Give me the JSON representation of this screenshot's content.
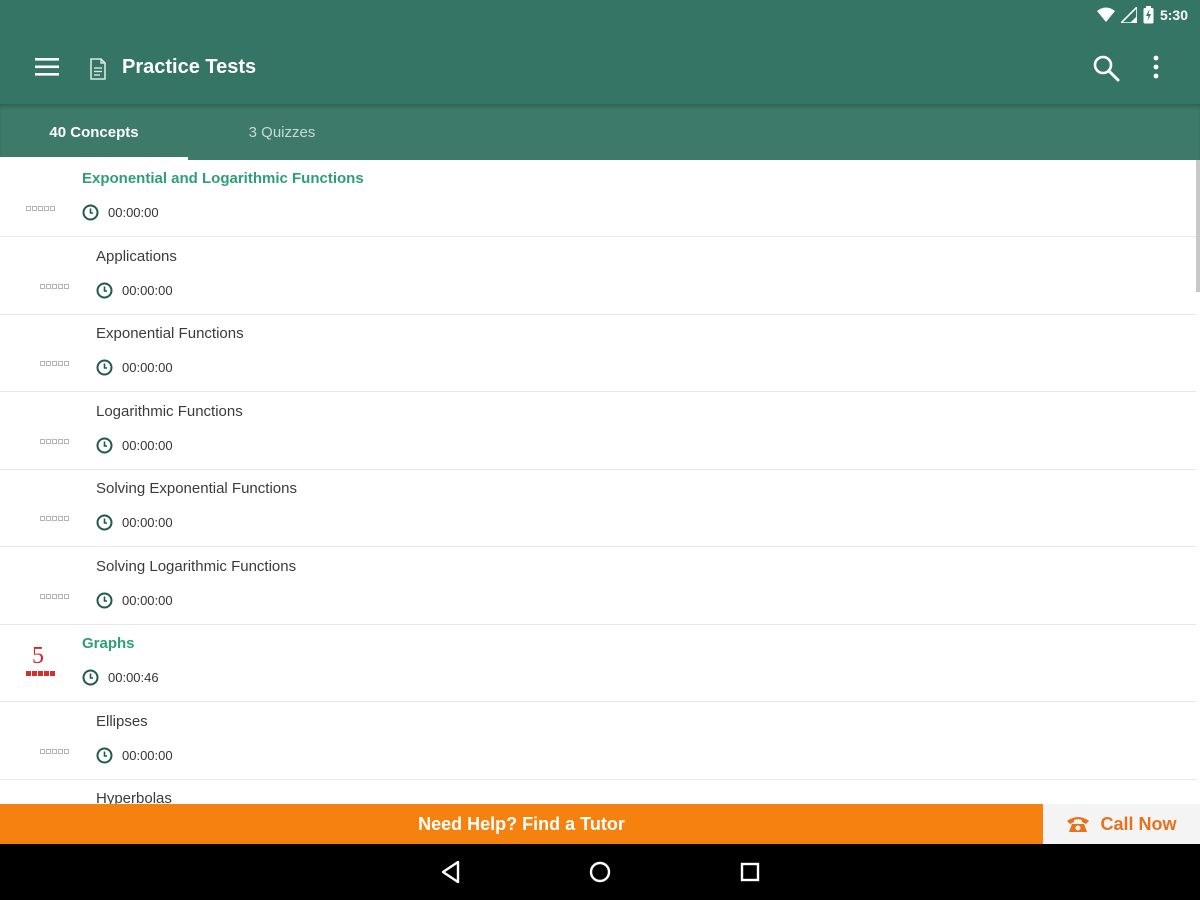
{
  "status": {
    "time": "5:30"
  },
  "toolbar": {
    "title": "Practice Tests"
  },
  "tabs": [
    {
      "label": "40 Concepts",
      "selected": true
    },
    {
      "label": "3 Quizzes",
      "selected": false
    }
  ],
  "list": {
    "rows": [
      {
        "title": "Exponential and Logarithmic Functions",
        "time": "00:00:00",
        "section": true
      },
      {
        "title": "Applications",
        "time": "00:00:00",
        "section": false
      },
      {
        "title": "Exponential Functions",
        "time": "00:00:00",
        "section": false
      },
      {
        "title": "Logarithmic Functions",
        "time": "00:00:00",
        "section": false
      },
      {
        "title": "Solving Exponential Functions",
        "time": "00:00:00",
        "section": false
      },
      {
        "title": "Solving Logarithmic Functions",
        "time": "00:00:00",
        "section": false
      },
      {
        "title": "Graphs",
        "time": "00:00:46",
        "section": true,
        "score": "5",
        "stars_filled": 5
      },
      {
        "title": "Ellipses",
        "time": "00:00:00",
        "section": false
      },
      {
        "title": "Hyperbolas",
        "time": "",
        "section": false
      }
    ]
  },
  "banner": {
    "help": "Need Help? Find a Tutor",
    "call": "Call Now"
  },
  "colors": {
    "primary": "#357566",
    "accent_green": "#2e9e7a",
    "banner_orange": "#f5820f",
    "call_orange": "#e8721c",
    "score_red": "#d02828"
  }
}
